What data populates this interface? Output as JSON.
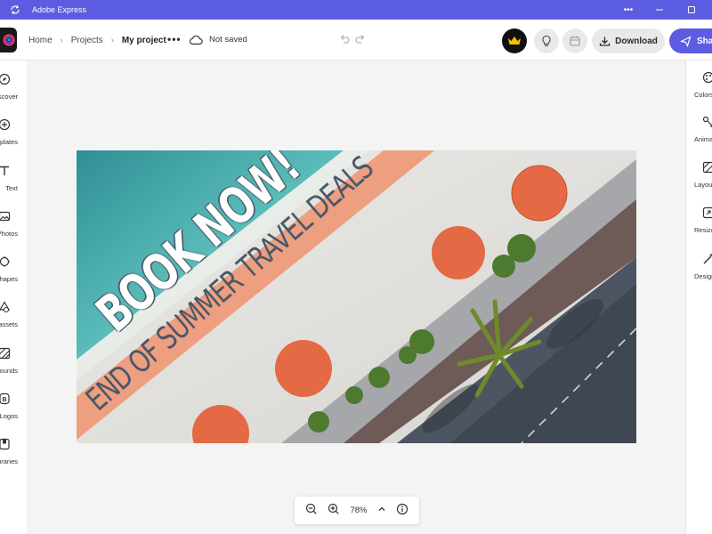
{
  "window": {
    "title": "Adobe Express"
  },
  "breadcrumb": {
    "home": "Home",
    "projects": "Projects",
    "current": "My project"
  },
  "status": {
    "save_state": "Not saved"
  },
  "actions": {
    "download_label": "Download",
    "share_label": "Share"
  },
  "left_rail": [
    {
      "label": "Discover",
      "icon": "compass-icon"
    },
    {
      "label": "Templates",
      "icon": "templates-icon"
    },
    {
      "label": "Text",
      "icon": "text-icon"
    },
    {
      "label": "Photos",
      "icon": "photo-icon"
    },
    {
      "label": "Shapes",
      "icon": "shapes-icon"
    },
    {
      "label": "Design assets",
      "icon": "design-assets-icon"
    },
    {
      "label": "Backgrounds",
      "icon": "backgrounds-icon"
    },
    {
      "label": "Logos",
      "icon": "logos-icon"
    },
    {
      "label": "Libraries",
      "icon": "libraries-icon"
    }
  ],
  "right_rail": [
    {
      "label": "Colors",
      "icon": "palette-icon"
    },
    {
      "label": "Animation",
      "icon": "animation-icon"
    },
    {
      "label": "Layout",
      "icon": "layout-icon"
    },
    {
      "label": "Resize",
      "icon": "resize-icon"
    },
    {
      "label": "Design",
      "icon": "magic-wand-icon"
    }
  ],
  "artboard": {
    "headline": "BOOK NOW!",
    "subheadline": "END OF SUMMER TRAVEL DEALS",
    "banner_color": "#ee9f80",
    "text_color": "#4a5868"
  },
  "zoom": {
    "level": "78%"
  },
  "theme": {
    "accent": "#5c5ce0",
    "premium": "#f2c200"
  }
}
